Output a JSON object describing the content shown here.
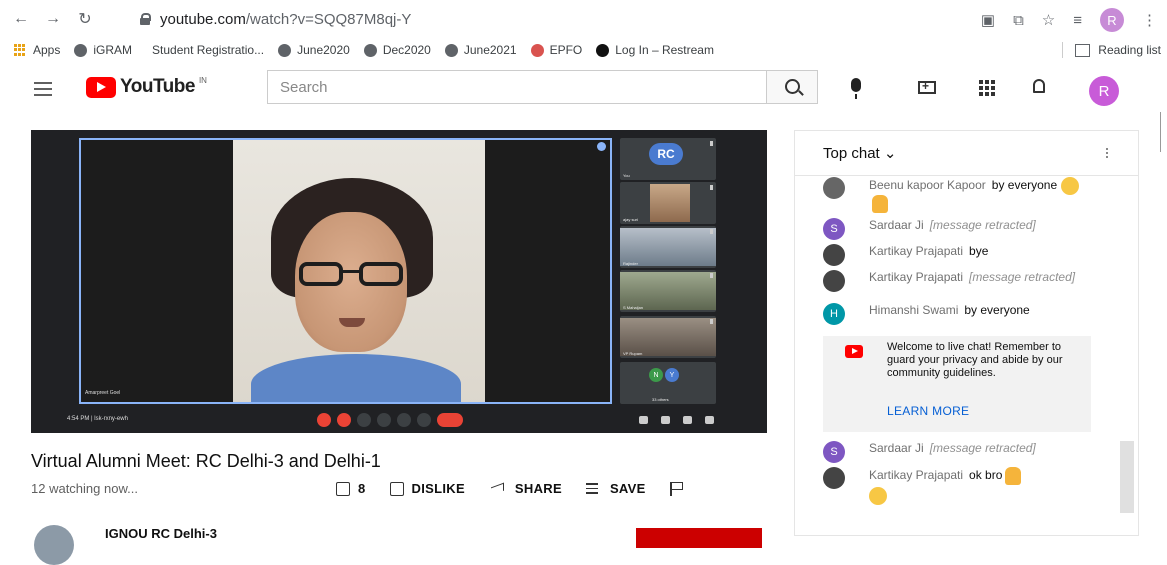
{
  "browser": {
    "url_host": "youtube.com",
    "url_path": "/watch?v=SQQ87M8qj-Y",
    "profile_initial": "R",
    "bookmarks": [
      "Apps",
      "iGRAM",
      "Student Registratio...",
      "June2020",
      "Dec2020",
      "June2021",
      "EPFO",
      "Log In – Restream"
    ],
    "reading_list": "Reading list"
  },
  "header": {
    "logo_text": "YouTube",
    "country_code": "IN",
    "search_placeholder": "Search",
    "avatar_initial": "R"
  },
  "player": {
    "main_participant": "Amarpreet Goel",
    "time_code": "4:54 PM | lsk-rxny-ewh",
    "side_tiles": [
      {
        "label": "You",
        "initials": "RC"
      },
      {
        "label": "ajay suri"
      },
      {
        "label": "Rajinder"
      },
      {
        "label": "S Mahaijan"
      },
      {
        "label": "VP Rupam"
      },
      {
        "label": "33 others",
        "chips": [
          "N",
          "Y"
        ]
      }
    ]
  },
  "video": {
    "title": "Virtual Alumni Meet: RC Delhi-3 and Delhi-1",
    "watching": "12 watching now...",
    "like_count": "8",
    "dislike_label": "DISLIKE",
    "share_label": "SHARE",
    "save_label": "SAVE",
    "channel_name": "IGNOU RC Delhi-3"
  },
  "chat": {
    "header": "Top chat",
    "messages": [
      {
        "author": "Beenu kapoor Kapoor",
        "text": "by everyone",
        "avatar": "",
        "avatar_color": "#666666"
      },
      {
        "author": "Sardaar Ji",
        "text": "[message retracted]",
        "retracted": true,
        "avatar": "S",
        "avatar_color": "#7e57c2"
      },
      {
        "author": "Kartikay Prajapati",
        "text": "bye",
        "avatar": "",
        "avatar_color": "#444444"
      },
      {
        "author": "Kartikay Prajapati",
        "text": "[message retracted]",
        "retracted": true,
        "avatar": "",
        "avatar_color": "#444444"
      },
      {
        "author": "Himanshi Swami",
        "text": "by everyone",
        "avatar": "H",
        "avatar_color": "#0097a7"
      },
      {
        "author": "Sardaar Ji",
        "text": "[message retracted]",
        "retracted": true,
        "avatar": "S",
        "avatar_color": "#7e57c2"
      },
      {
        "author": "Kartikay Prajapati",
        "text": "ok bro",
        "avatar": "",
        "avatar_color": "#444444"
      }
    ],
    "welcome_text": "Welcome to live chat! Remember to guard your privacy and abide by our community guidelines.",
    "learn_more": "LEARN MORE"
  },
  "colors": {
    "brand_red": "#ff0000",
    "link_blue": "#065fd4",
    "avatar_purple": "#c85bd8"
  }
}
